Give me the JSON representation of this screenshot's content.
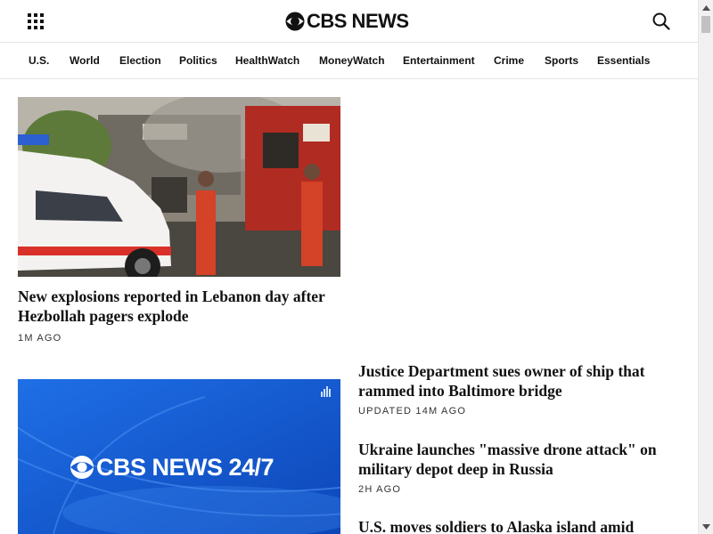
{
  "header": {
    "logo_text": "CBS NEWS",
    "menu_icon": "grid-menu-icon",
    "search_icon": "search-icon"
  },
  "nav": {
    "items": [
      {
        "label": "U.S."
      },
      {
        "label": "World"
      },
      {
        "label": "Election"
      },
      {
        "label": "Politics"
      },
      {
        "label": "HealthWatch"
      },
      {
        "label": "MoneyWatch"
      },
      {
        "label": "Entertainment"
      },
      {
        "label": "Crime"
      },
      {
        "label": "Sports"
      },
      {
        "label": "Essentials"
      }
    ]
  },
  "main_story": {
    "headline": "New explosions reported in Lebanon day after Hezbollah pagers explode",
    "time": "1M AGO"
  },
  "stream": {
    "logo_text": "CBS NEWS 24/7"
  },
  "side_stories": [
    {
      "headline": "Justice Department sues owner of ship that rammed into Baltimore bridge",
      "time": "UPDATED 14M AGO"
    },
    {
      "headline": "Ukraine launches \"massive drone attack\" on military depot deep in Russia",
      "time": "2H AGO"
    },
    {
      "headline": "U.S. moves soldiers to Alaska island amid"
    }
  ],
  "colors": {
    "text": "#101010",
    "divider": "#e5e5e5",
    "stream_blue": "#1565d8"
  }
}
